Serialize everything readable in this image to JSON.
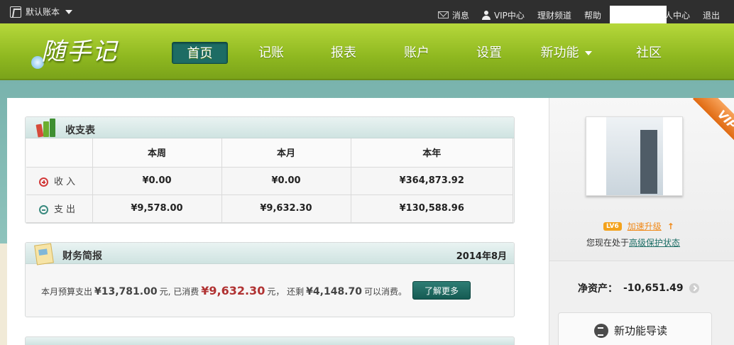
{
  "topbar": {
    "account_book": "默认账本",
    "links": {
      "messages": "消息",
      "vip_center": "VIP中心",
      "finance_channel": "理财频道",
      "help": "帮助",
      "personal_center_partial": "人中心",
      "logout": "退出"
    }
  },
  "logo": {
    "text": "随手记"
  },
  "nav": {
    "items": [
      "首页",
      "记账",
      "报表",
      "账户",
      "设置",
      "新功能",
      "社区"
    ],
    "active": "首页"
  },
  "income_expense": {
    "title": "收支表",
    "columns": [
      "本周",
      "本月",
      "本年"
    ],
    "rows": [
      {
        "label": "收入",
        "values": [
          "¥0.00",
          "¥0.00",
          "¥364,873.92"
        ]
      },
      {
        "label": "支出",
        "values": [
          "¥9,578.00",
          "¥9,632.30",
          "¥130,588.96"
        ]
      }
    ]
  },
  "brief": {
    "title": "财务简报",
    "period": "2014年8月",
    "text_budget": "本月预算支出",
    "budget": "¥13,781.00",
    "text_spent": "元, 已消费",
    "spent": "¥9,632.30",
    "text_remaining": "元， 还剩",
    "remaining": "¥4,148.70",
    "text_tail": "可以消费。",
    "button": "了解更多"
  },
  "sidebar": {
    "vip_label": "VIP",
    "level": "LV6",
    "upgrade": "加速升级",
    "protect_prefix": "您现在处于",
    "protect_link": "高级保护状态",
    "networth_label": "净资产：",
    "networth_value": "-10,651.49",
    "guide": "新功能导读"
  },
  "colors": {
    "accent_green": "#8fb820",
    "teal": "#1d6c64",
    "income_red": "#d23a3a",
    "expense_teal": "#3a8a7f",
    "vip_orange": "#e06a12"
  }
}
